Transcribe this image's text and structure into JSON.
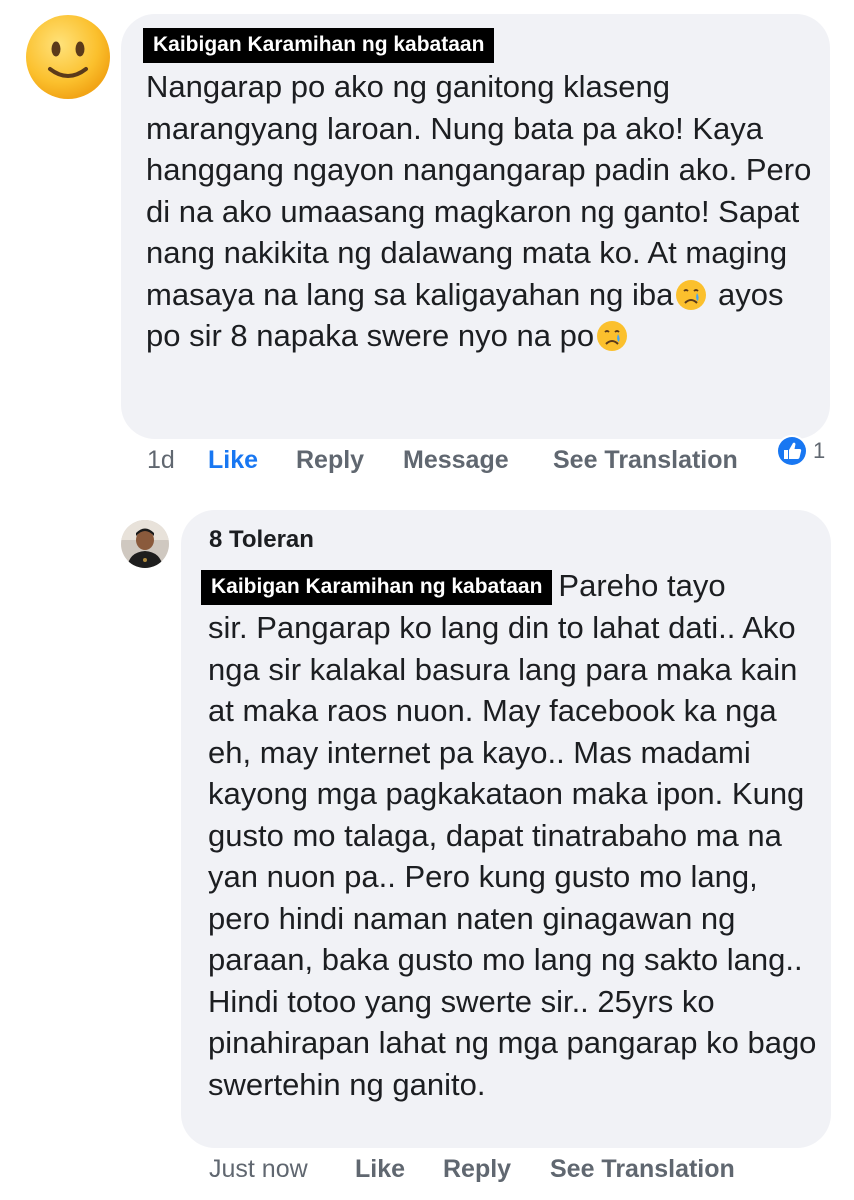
{
  "comment": {
    "avatar_icon": "smiley-emoji-icon",
    "name_tag": "Kaibigan Karamihan ng kabataan",
    "text_part1": "Nangarap po ako ng ganitong klaseng marangyang laroan. Nung bata pa ako! Kaya hanggang ngayon nangangarap padin ako. Pero di na ako umaasang magkaron ng ganto! Sapat nang nakikita ng dalawang mata ko. At maging masaya na lang sa kaligayahan ng iba",
    "text_part2": " ayos po sir 8 napaka swere nyo na po",
    "emoji_icon": "crying-face-icon",
    "actions": {
      "time": "1d",
      "like": "Like",
      "reply": "Reply",
      "message": "Message",
      "see_translation": "See Translation"
    },
    "reaction": {
      "icon": "thumbs-up-icon",
      "count": "1",
      "color": "#1877f2"
    }
  },
  "reply": {
    "avatar_icon": "profile-photo-avatar",
    "author": "8 Toleran",
    "name_tag": "Kaibigan Karamihan ng kabataan",
    "text_first": "Pareho tayo",
    "text_rest": "sir. Pangarap ko lang din to lahat dati.. Ako nga sir kalakal basura lang para maka kain at maka raos nuon. May facebook ka nga eh, may internet pa kayo.. Mas madami kayong mga pagkakataon maka ipon. Kung gusto mo talaga, dapat tinatrabaho ma na yan nuon pa.. Pero kung gusto mo lang, pero hindi naman naten ginagawan ng paraan, baka gusto mo lang ng sakto lang.. Hindi totoo yang swerte sir.. 25yrs ko pinahirapan lahat ng mga pangarap ko bago swertehin ng ganito.",
    "actions": {
      "time": "Just now",
      "like": "Like",
      "reply": "Reply",
      "see_translation": "See Translation"
    }
  },
  "colors": {
    "bubble_bg": "#f1f2f6",
    "meta_text": "#606770",
    "like_active": "#1877f2",
    "name_tag_bg": "#000000"
  }
}
